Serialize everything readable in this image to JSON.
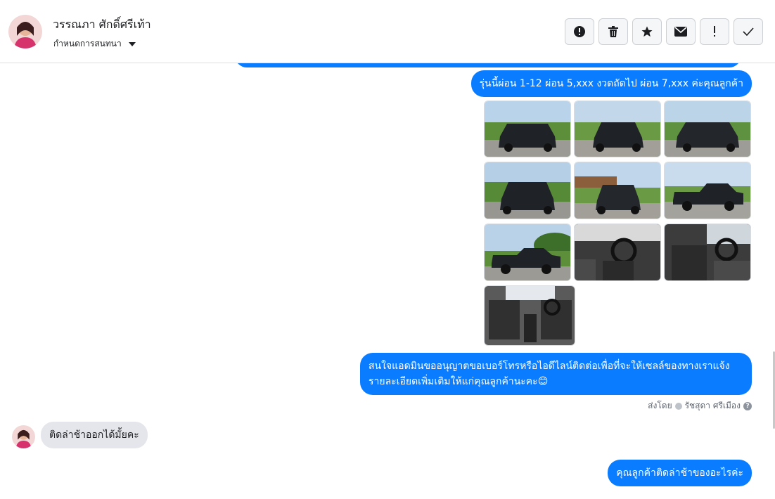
{
  "header": {
    "contact_name": "วรรณภา ศักดิ์ศรีเท้า",
    "assign_label": "กำหนดการสนทนา",
    "actions": [
      {
        "icon": "alert-circle-icon",
        "label": "Mark as spam"
      },
      {
        "icon": "trash-icon",
        "label": "Delete"
      },
      {
        "icon": "star-icon",
        "label": "Star"
      },
      {
        "icon": "envelope-icon",
        "label": "Mark as unread"
      },
      {
        "icon": "exclamation-icon",
        "label": "Follow up"
      },
      {
        "icon": "check-icon",
        "label": "Done"
      }
    ]
  },
  "messages": {
    "out_1": "รุ่นนี้ผ่อน 1-12 ผ่อน 5,xxx งวดถัดไป ผ่อน 7,xxx ค่ะคุณลูกค้า",
    "out_2": "สนใจแอดมินขออนุญาตขอเบอร์โทรหรือไอดีไลน์ติดต่อเพื่อที่จะให้เซลล์ของทางเราแจ้งรายละเอียดเพิ่มเติมให้แก่คุณลูกค้านะคะ😊",
    "sent_by_label": "ส่งโดย",
    "sent_by_name": "รัชสุดา ศรีเมือง",
    "in_1": "ติดล่าช้าออกได้มั้ยคะ",
    "out_3": "คุณลูกค้าติดล่าช้าของอะไรค่ะ"
  },
  "photos": {
    "count": 10,
    "colors": {
      "sky": "#b9d3ea",
      "grass": "#5d8f3a",
      "road": "#9b9a94",
      "truck": "#1f2328",
      "interior": "#3a3a3a"
    }
  }
}
